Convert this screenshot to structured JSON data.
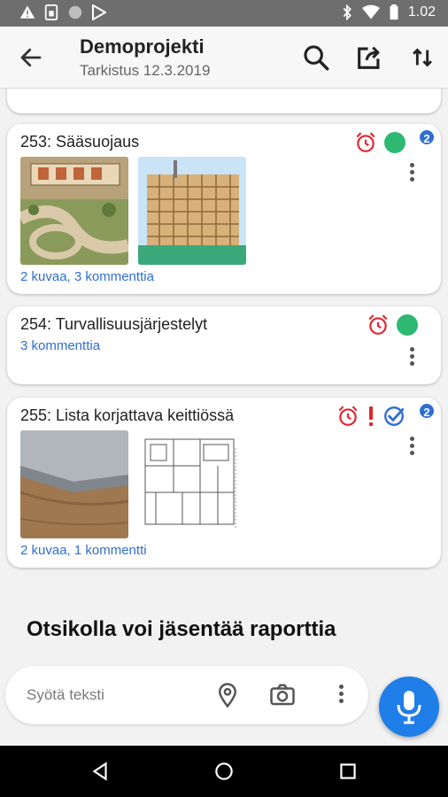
{
  "status_bar": {
    "time": "1.02",
    "left_icons": [
      "warning-icon",
      "sim-icon",
      "circle-icon",
      "play-store-icon"
    ],
    "right_icons": [
      "bluetooth-icon",
      "wifi-icon",
      "battery-icon"
    ]
  },
  "app_bar": {
    "title": "Demoprojekti",
    "subtitle": "Tarkistus 12.3.2019",
    "actions": [
      "search-icon",
      "share-icon",
      "sort-icon"
    ]
  },
  "cards": [
    {
      "title": "253: Sääsuojaus",
      "meta": "2 kuvaa, 3 kommenttia",
      "badge": "2",
      "status": "green-dot",
      "images": [
        "site-plan-image",
        "building-scaffold-image"
      ]
    },
    {
      "title": "254: Turvallisuusjärjestelyt",
      "meta": "3 kommenttia",
      "status": "green-dot"
    },
    {
      "title": "255: Lista korjattava keittiössä",
      "meta": "2 kuvaa, 1 kommentti",
      "badge": "2",
      "status": "check-icon",
      "images": [
        "metal-edge-image",
        "floor-plan-image"
      ]
    }
  ],
  "section_heading": "Otsikolla voi jäsentää raporttia",
  "input": {
    "placeholder": "Syötä teksti"
  },
  "colors": {
    "accent": "#1f7ee8",
    "alarm": "#e0262f",
    "status_green": "#2eb872",
    "link": "#2f6fd0"
  }
}
